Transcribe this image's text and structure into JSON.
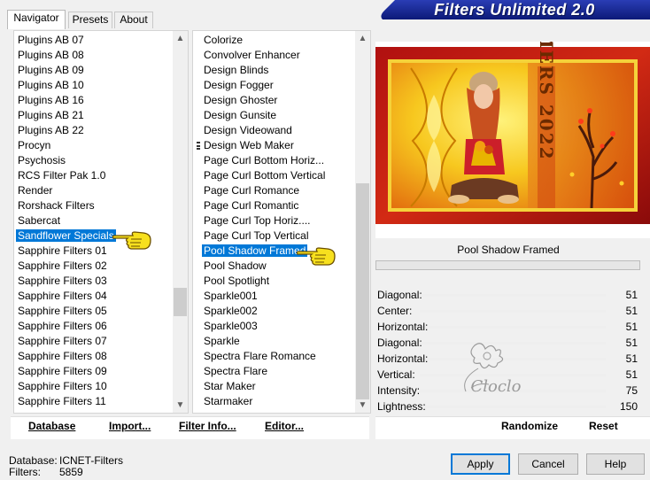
{
  "header": {
    "tabs": [
      "Navigator",
      "Presets",
      "About"
    ],
    "active_tab": "Navigator",
    "app_title": "Filters Unlimited 2.0"
  },
  "categories": {
    "items": [
      "Plugins AB 07",
      "Plugins AB 08",
      "Plugins AB 09",
      "Plugins AB 10",
      "Plugins AB 16",
      "Plugins AB 21",
      "Plugins AB 22",
      "Procyn",
      "Psychosis",
      "RCS Filter Pak 1.0",
      "Render",
      "Rorshack Filters",
      "Sabercat",
      "Sandflower Specials",
      "Sapphire Filters 01",
      "Sapphire Filters 02",
      "Sapphire Filters 03",
      "Sapphire Filters 04",
      "Sapphire Filters 05",
      "Sapphire Filters 06",
      "Sapphire Filters 07",
      "Sapphire Filters 08",
      "Sapphire Filters 09",
      "Sapphire Filters 10",
      "Sapphire Filters 11"
    ],
    "selected": "Sandflower Specials"
  },
  "filters": {
    "items": [
      "Colorize",
      "Convolver Enhancer",
      "Design Blinds",
      "Design Fogger",
      "Design Ghoster",
      "Design Gunsite",
      "Design Videowand",
      "Design Web Maker",
      "Page Curl Bottom Horiz...",
      "Page Curl Bottom Vertical",
      "Page Curl Romance",
      "Page Curl Romantic",
      "Page Curl Top Horiz....",
      "Page Curl Top Vertical",
      "Pool Shadow Framed",
      "Pool Shadow",
      "Pool Spotlight",
      "Sparkle001",
      "Sparkle002",
      "Sparkle003",
      "Sparkle",
      "Spectra Flare Romance",
      "Spectra Flare",
      "Star Maker",
      "Starmaker"
    ],
    "selected": "Pool Shadow Framed"
  },
  "preview": {
    "filter_name": "Pool Shadow Framed",
    "art_text": "MERS 2022",
    "watermark_text": "Cloclo"
  },
  "parameters": [
    {
      "label": "Diagonal:",
      "value": "51"
    },
    {
      "label": "Center:",
      "value": "51"
    },
    {
      "label": "Horizontal:",
      "value": "51"
    },
    {
      "label": "Diagonal:",
      "value": "51"
    },
    {
      "label": "Horizontal:",
      "value": "51"
    },
    {
      "label": "Vertical:",
      "value": "51"
    },
    {
      "label": "Intensity:",
      "value": "75"
    },
    {
      "label": "Lightness:",
      "value": "150"
    }
  ],
  "toolbar": {
    "database_label": "Database",
    "import_label": "Import...",
    "filter_info_label": "Filter Info...",
    "editor_label": "Editor...",
    "randomize_label": "Randomize",
    "reset_label": "Reset"
  },
  "status": {
    "database_label": "Database:",
    "database_value": "ICNET-Filters",
    "filters_label": "Filters:",
    "filters_value": "5859"
  },
  "buttons": {
    "apply": "Apply",
    "cancel": "Cancel",
    "help": "Help"
  },
  "colors": {
    "accent": "#0078d7",
    "banner": "#1a2a9a"
  },
  "icons": [
    "pointing-hand-icon",
    "scroll-up-arrow-icon",
    "scroll-down-arrow-icon"
  ]
}
